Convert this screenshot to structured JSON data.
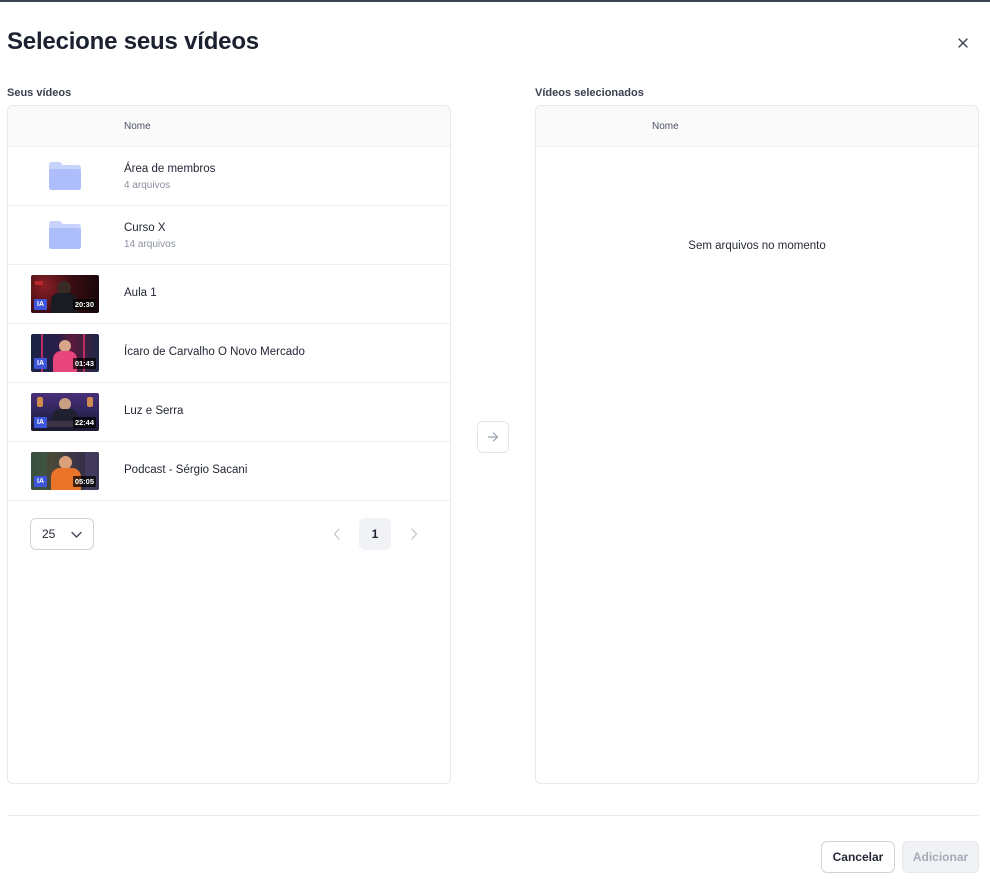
{
  "modal": {
    "title": "Selecione seus vídeos",
    "close_icon": "close-icon"
  },
  "left_panel": {
    "label": "Seus vídeos",
    "column_name": "Nome",
    "rows": [
      {
        "type": "folder",
        "name": "Área de membros",
        "sub": "4 arquivos",
        "icon": "folder-icon"
      },
      {
        "type": "folder",
        "name": "Curso X",
        "sub": "14 arquivos",
        "icon": "folder-icon"
      },
      {
        "type": "video",
        "name": "Aula 1",
        "badge": "IA",
        "duration": "20:30"
      },
      {
        "type": "video",
        "name": "Ícaro de Carvalho O Novo Mercado",
        "badge": "IA",
        "duration": "01:43"
      },
      {
        "type": "video",
        "name": "Luz e Serra",
        "badge": "IA",
        "duration": "22:44"
      },
      {
        "type": "video",
        "name": "Podcast - Sérgio Sacani",
        "badge": "IA",
        "duration": "05:05"
      }
    ],
    "pagination": {
      "page_size": "25",
      "current_page": "1"
    }
  },
  "transfer_button": {
    "icon": "arrow-right-icon"
  },
  "right_panel": {
    "label": "Vídeos selecionados",
    "column_name": "Nome",
    "empty_text": "Sem arquivos no momento"
  },
  "footer": {
    "cancel_label": "Cancelar",
    "add_label": "Adicionar"
  },
  "colors": {
    "folder": "#aebefc",
    "folder_tab": "#c7d3fd",
    "ia_badge": "#3d55d8",
    "primary_text": "#1f2430",
    "muted_text": "#8a90a0"
  }
}
